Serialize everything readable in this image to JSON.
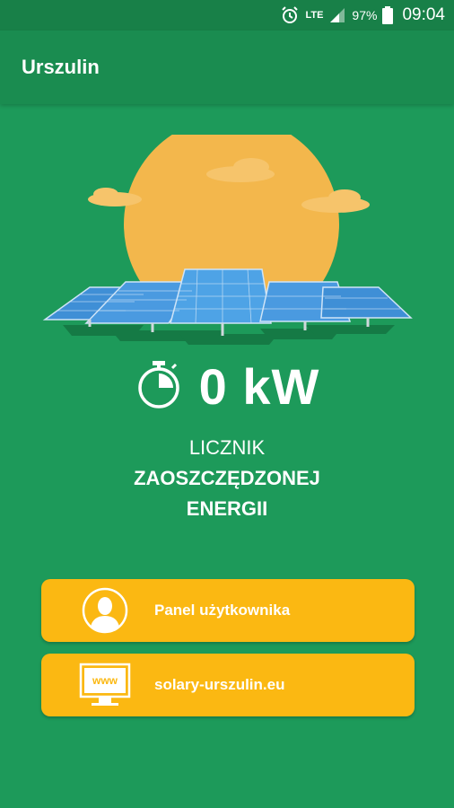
{
  "status_bar": {
    "network": "LTE",
    "battery": "97%",
    "time": "09:04"
  },
  "app_bar": {
    "title": "Urszulin"
  },
  "counter": {
    "value": "0 kW",
    "caption_line1": "LICZNIK",
    "caption_line2": "ZAOSZCZĘDZONEJ",
    "caption_line3": "ENERGII"
  },
  "buttons": [
    {
      "label": "Panel użytkownika",
      "icon": "user-avatar-icon"
    },
    {
      "label": "solary-urszulin.eu",
      "icon": "monitor-www-icon",
      "icon_text": "www"
    }
  ],
  "colors": {
    "background": "#1d9a5a",
    "app_bar": "#1a8c50",
    "status_bar": "#188048",
    "button": "#fbb812",
    "sun": "#f3b74c",
    "panel": "#3f8fd6"
  }
}
